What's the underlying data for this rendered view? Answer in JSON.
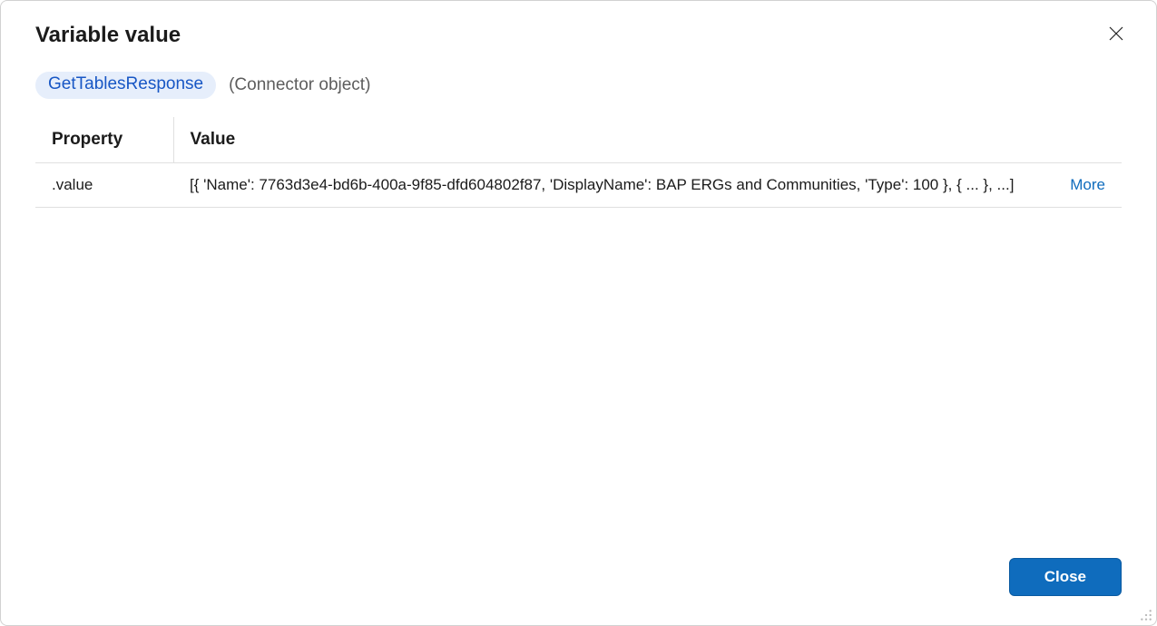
{
  "dialog": {
    "title": "Variable value",
    "close_label": "Close"
  },
  "subheader": {
    "pill": "GetTablesResponse",
    "object_type": "(Connector object)"
  },
  "table": {
    "headers": {
      "property": "Property",
      "value": "Value"
    },
    "rows": [
      {
        "property": ".value",
        "value": "[{ 'Name': 7763d3e4-bd6b-400a-9f85-dfd604802f87, 'DisplayName': BAP ERGs and Communities, 'Type': 100 }, {  ... },  ...]",
        "more_label": "More"
      }
    ]
  },
  "footer": {
    "close_button": "Close"
  }
}
